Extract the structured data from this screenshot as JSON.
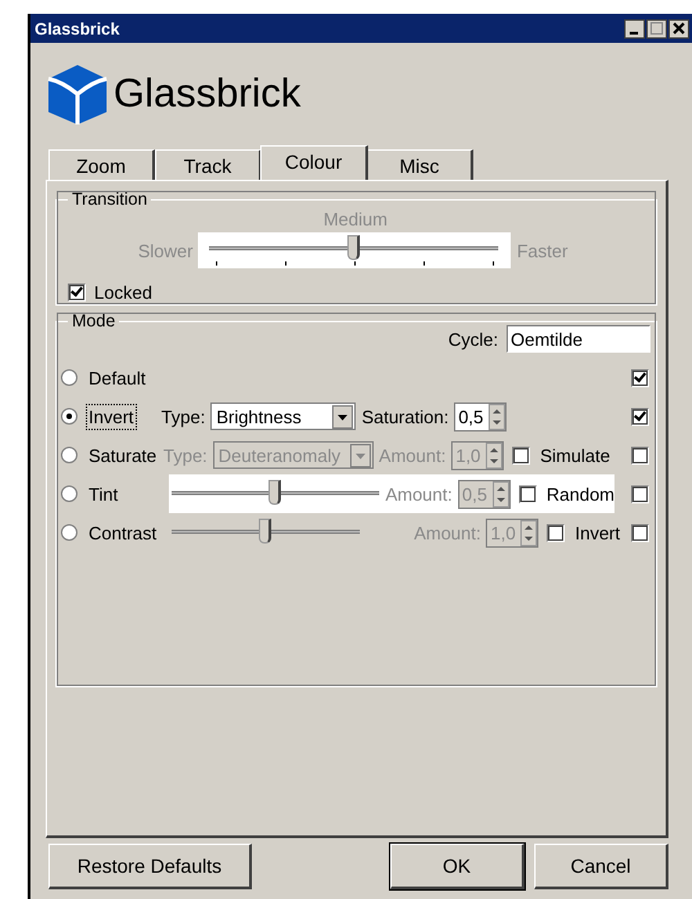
{
  "window": {
    "title": "Glassbrick"
  },
  "logo": {
    "text": "Glassbrick"
  },
  "tabs": [
    {
      "label": "Zoom",
      "selected": false
    },
    {
      "label": "Track",
      "selected": false
    },
    {
      "label": "Colour",
      "selected": true
    },
    {
      "label": "Misc",
      "selected": false
    }
  ],
  "transition": {
    "title": "Transition",
    "heading": "Medium",
    "left": "Slower",
    "right": "Faster",
    "level": 0.5,
    "disabled": true,
    "locked": {
      "label": "Locked",
      "checked": true
    }
  },
  "mode": {
    "title": "Mode",
    "cycle": {
      "label": "Cycle:",
      "value": "Oemtilde"
    },
    "rows": [
      {
        "kind": "plain",
        "label": "Default",
        "selected": false,
        "checked": true
      },
      {
        "kind": "type",
        "label": "Invert",
        "selected": true,
        "focused": true,
        "disabled": false,
        "type_label": "Type:",
        "type_value": "Brightness",
        "amount_label": "Saturation:",
        "amount_value": "0,5",
        "checked": true
      },
      {
        "kind": "type",
        "label": "Saturate",
        "selected": false,
        "disabled": true,
        "type_label": "Type:",
        "type_value": "Deuteranomaly",
        "amount_label": "Amount:",
        "amount_value": "1,0",
        "option": {
          "label": "Simulate",
          "checked": false
        },
        "checked": false
      },
      {
        "kind": "slider",
        "label": "Tint",
        "selected": false,
        "highlighted": true,
        "level": 0.5,
        "amount_label": "Amount:",
        "amount_value": "0,5",
        "option": {
          "label": "Random",
          "checked": false
        },
        "checked": false
      },
      {
        "kind": "slider",
        "label": "Contrast",
        "selected": false,
        "highlighted": false,
        "level": 0.5,
        "amount_label": "Amount:",
        "amount_value": "1,0",
        "option": {
          "label": "Invert",
          "checked": false
        },
        "checked": false
      }
    ]
  },
  "buttons": [
    {
      "label": "Restore Defaults",
      "default": false
    },
    {
      "label": "OK",
      "default": true
    },
    {
      "label": "Cancel",
      "default": false
    }
  ]
}
